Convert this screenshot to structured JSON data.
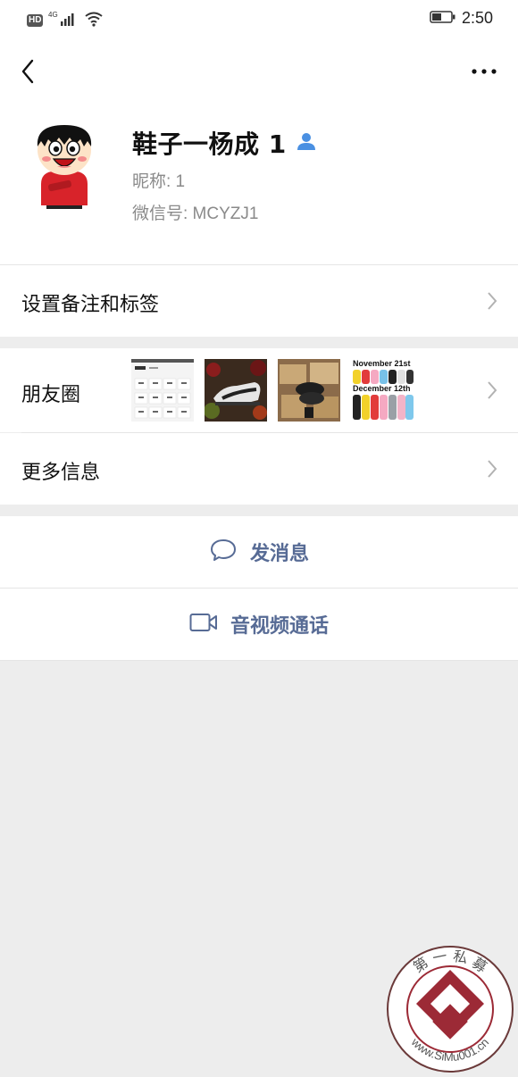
{
  "status_bar": {
    "hd_label": "HD",
    "network_label": "4G",
    "time": "2:50"
  },
  "nav": {
    "back_icon": "back-chevron-icon",
    "more_icon": "more-dots-icon"
  },
  "profile": {
    "display_name": "鞋子一杨成 1",
    "nickname": "昵称: 1",
    "wechat_id": "微信号: MCYZJ1"
  },
  "rows": {
    "remark_label": "设置备注和标签",
    "moments_label": "朋友圈",
    "more_info_label": "更多信息"
  },
  "moments_thumbs": {
    "thumb4_line1": "November 21st",
    "thumb4_line2": "December 12th"
  },
  "actions": {
    "message_label": "发消息",
    "call_label": "音视频通话"
  },
  "watermark": {
    "top_text": "第 一 私 募",
    "bottom_text": "www.SiMu001.cn"
  },
  "colors": {
    "link_blue": "#576b95",
    "background": "#ededed",
    "secondary_text": "#8a8a8a"
  }
}
